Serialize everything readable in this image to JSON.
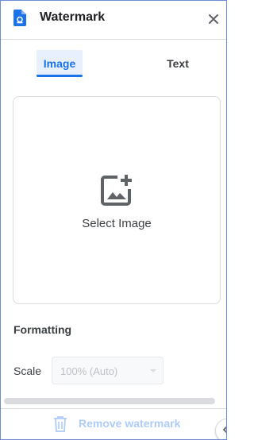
{
  "header": {
    "title": "Watermark",
    "doc_icon": "watermark-doc-icon",
    "close_icon": "close-icon"
  },
  "tabs": [
    {
      "label": "Image",
      "selected": true
    },
    {
      "label": "Text",
      "selected": false
    }
  ],
  "image_panel": {
    "select_label": "Select Image",
    "icon": "add-photo-icon"
  },
  "formatting": {
    "heading": "Formatting",
    "scale_label": "Scale",
    "scale_value": "100% (Auto)",
    "scale_disabled": true
  },
  "footer": {
    "remove_label": "Remove watermark",
    "remove_disabled": true,
    "trash_icon": "trash-icon"
  },
  "colors": {
    "accent": "#1a73e8",
    "accent_bg": "#e8f0fe",
    "disabled_text": "#aecbfa",
    "frame_border": "#6b8fd6"
  }
}
